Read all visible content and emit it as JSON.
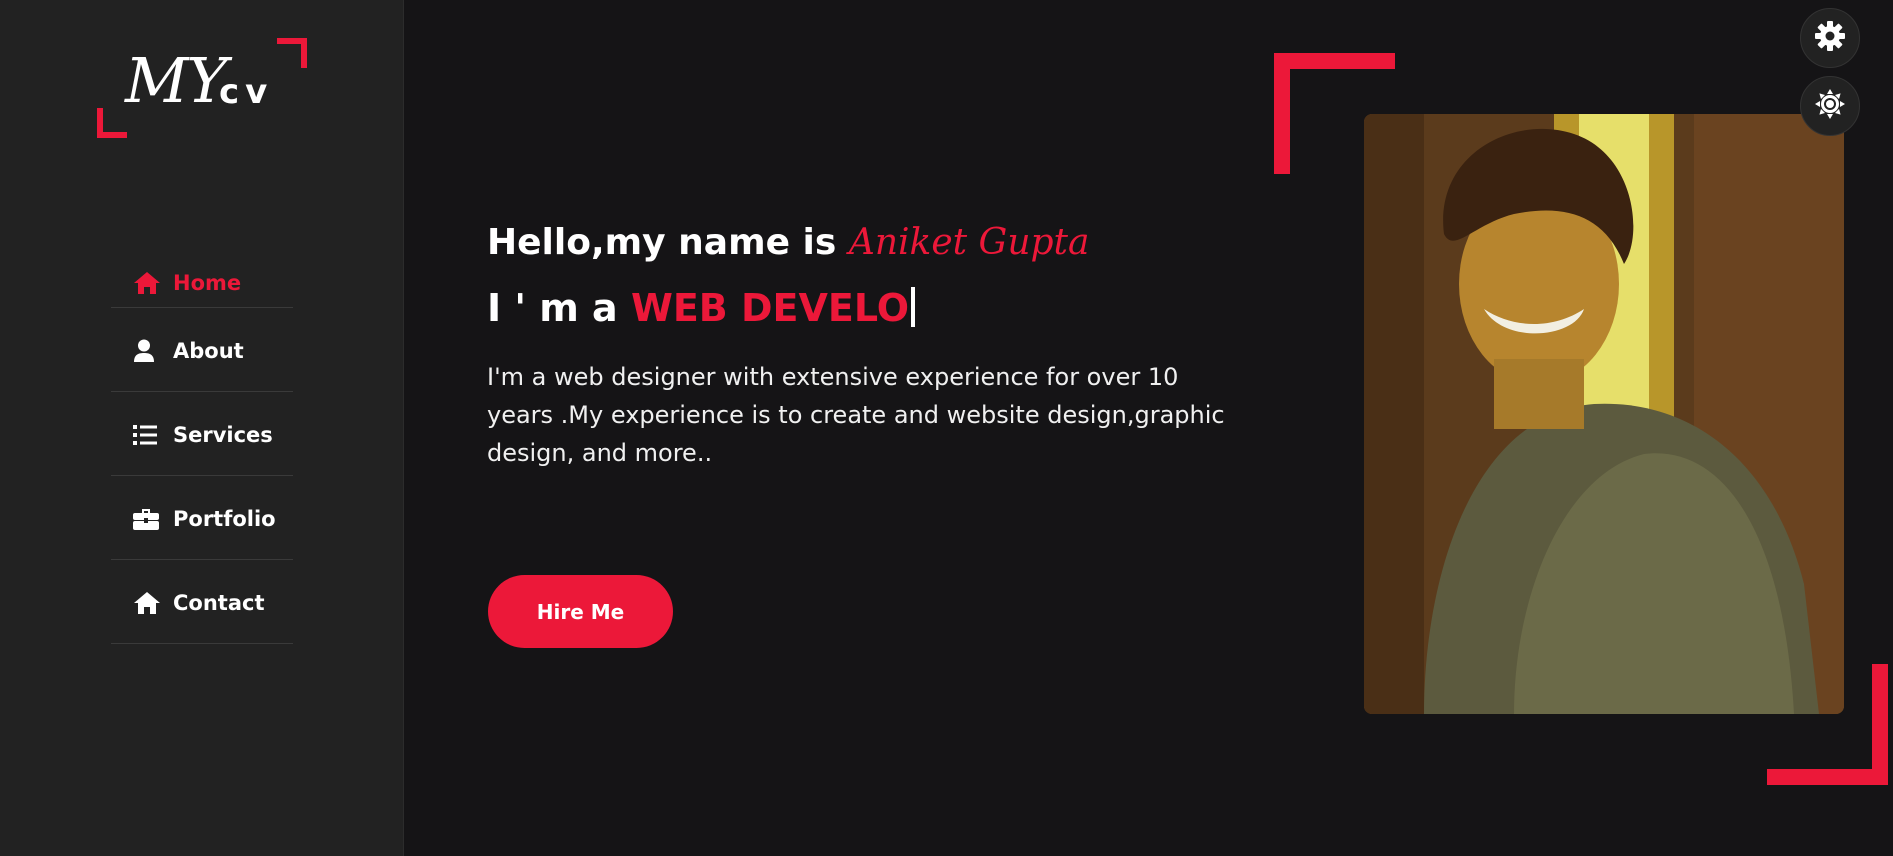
{
  "logo": {
    "script": "MY",
    "suffix": "cv"
  },
  "nav": {
    "items": [
      {
        "label": "Home",
        "icon": "home-icon",
        "active": true
      },
      {
        "label": "About",
        "icon": "user-icon",
        "active": false
      },
      {
        "label": "Services",
        "icon": "list-icon",
        "active": false
      },
      {
        "label": "Portfolio",
        "icon": "briefcase-icon",
        "active": false
      },
      {
        "label": "Contact",
        "icon": "home-icon",
        "active": false
      }
    ]
  },
  "hero": {
    "greeting": "Hello,my name is ",
    "name": "Aniket Gupta",
    "role_prefix": "I ' m a ",
    "role_typed": "WEB DEVELO",
    "description": "I'm a web designer with extensive experience for over 10 years .My experience is to create and website design,graphic design, and more..",
    "hire_label": "Hire Me"
  },
  "floating": {
    "settings_icon": "gear-icon",
    "theme_icon": "sun-icon"
  },
  "colors": {
    "accent": "#ec1839",
    "sidebar_bg": "#222222",
    "main_bg": "#151416"
  }
}
